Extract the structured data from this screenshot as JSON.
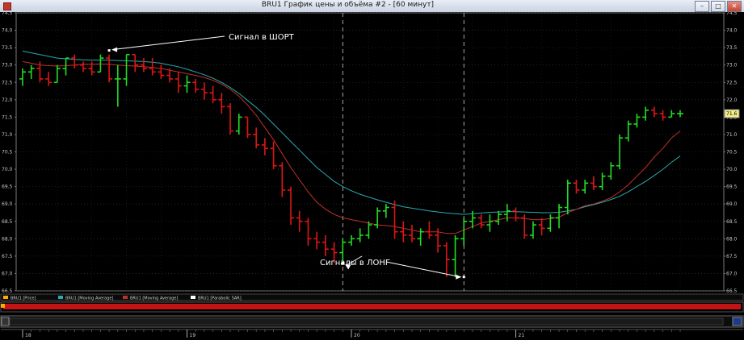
{
  "window": {
    "title": "BRU1 График цены и объёма #2 - [60 минут]",
    "buttons": [
      "–",
      "□",
      "✕"
    ]
  },
  "chart_data": {
    "type": "ohlc",
    "symbol": "BRU1",
    "ylim": [
      66.5,
      74.5
    ],
    "y_ticks": [
      "74.5",
      "74.0",
      "73.5",
      "73.0",
      "72.5",
      "72.0",
      "71.5",
      "71.0",
      "70.5",
      "70.0",
      "69.5",
      "69.0",
      "68.5",
      "68.0",
      "67.5",
      "67.0",
      "66.5"
    ],
    "y_axis_side": "both",
    "last_price_label": "71.6",
    "grid": true,
    "bars": [
      {
        "o": 72.6,
        "h": 72.9,
        "l": 72.4,
        "c": 72.8
      },
      {
        "o": 72.8,
        "h": 73.0,
        "l": 72.6,
        "c": 72.9
      },
      {
        "o": 72.9,
        "h": 73.1,
        "l": 72.5,
        "c": 72.6
      },
      {
        "o": 72.6,
        "h": 72.8,
        "l": 72.4,
        "c": 72.5
      },
      {
        "o": 72.5,
        "h": 73.0,
        "l": 72.5,
        "c": 72.9
      },
      {
        "o": 72.9,
        "h": 73.2,
        "l": 72.7,
        "c": 73.2
      },
      {
        "o": 73.2,
        "h": 73.3,
        "l": 72.9,
        "c": 73.0
      },
      {
        "o": 73.0,
        "h": 73.1,
        "l": 72.8,
        "c": 72.9
      },
      {
        "o": 72.9,
        "h": 73.1,
        "l": 72.7,
        "c": 72.8
      },
      {
        "o": 72.8,
        "h": 73.3,
        "l": 72.8,
        "c": 73.2
      },
      {
        "o": 73.2,
        "h": 73.3,
        "l": 72.5,
        "c": 72.6
      },
      {
        "o": 72.6,
        "h": 73.0,
        "l": 71.8,
        "c": 72.6
      },
      {
        "o": 72.6,
        "h": 73.3,
        "l": 72.4,
        "c": 73.3
      },
      {
        "o": 73.3,
        "h": 73.3,
        "l": 72.8,
        "c": 73.0
      },
      {
        "o": 73.0,
        "h": 73.2,
        "l": 72.8,
        "c": 72.9
      },
      {
        "o": 72.9,
        "h": 73.2,
        "l": 72.7,
        "c": 72.8
      },
      {
        "o": 72.8,
        "h": 73.0,
        "l": 72.6,
        "c": 72.7
      },
      {
        "o": 72.7,
        "h": 72.9,
        "l": 72.5,
        "c": 72.6
      },
      {
        "o": 72.6,
        "h": 72.8,
        "l": 72.2,
        "c": 72.4
      },
      {
        "o": 72.4,
        "h": 72.7,
        "l": 72.2,
        "c": 72.5
      },
      {
        "o": 72.5,
        "h": 72.6,
        "l": 72.2,
        "c": 72.3
      },
      {
        "o": 72.3,
        "h": 72.5,
        "l": 72.0,
        "c": 72.2
      },
      {
        "o": 72.2,
        "h": 72.4,
        "l": 71.9,
        "c": 72.0
      },
      {
        "o": 72.0,
        "h": 72.2,
        "l": 71.6,
        "c": 71.8
      },
      {
        "o": 71.8,
        "h": 71.9,
        "l": 71.0,
        "c": 71.1
      },
      {
        "o": 71.1,
        "h": 71.6,
        "l": 71.0,
        "c": 71.5
      },
      {
        "o": 71.5,
        "h": 71.5,
        "l": 70.9,
        "c": 71.0
      },
      {
        "o": 71.0,
        "h": 71.2,
        "l": 70.6,
        "c": 70.7
      },
      {
        "o": 70.7,
        "h": 70.9,
        "l": 70.4,
        "c": 70.6
      },
      {
        "o": 70.6,
        "h": 70.8,
        "l": 70.0,
        "c": 70.1
      },
      {
        "o": 70.1,
        "h": 70.2,
        "l": 69.2,
        "c": 69.4
      },
      {
        "o": 69.4,
        "h": 69.5,
        "l": 68.4,
        "c": 68.6
      },
      {
        "o": 68.6,
        "h": 68.8,
        "l": 68.2,
        "c": 68.5
      },
      {
        "o": 68.5,
        "h": 68.6,
        "l": 67.8,
        "c": 68.0
      },
      {
        "o": 68.0,
        "h": 68.2,
        "l": 67.7,
        "c": 67.9
      },
      {
        "o": 67.9,
        "h": 68.1,
        "l": 67.5,
        "c": 67.7
      },
      {
        "o": 67.7,
        "h": 67.9,
        "l": 67.3,
        "c": 67.6
      },
      {
        "o": 67.6,
        "h": 68.0,
        "l": 67.3,
        "c": 67.9
      },
      {
        "o": 67.9,
        "h": 68.1,
        "l": 67.8,
        "c": 68.0
      },
      {
        "o": 68.0,
        "h": 68.3,
        "l": 67.9,
        "c": 68.1
      },
      {
        "o": 68.1,
        "h": 68.5,
        "l": 68.0,
        "c": 68.4
      },
      {
        "o": 68.4,
        "h": 68.9,
        "l": 68.3,
        "c": 68.8
      },
      {
        "o": 68.8,
        "h": 69.0,
        "l": 68.6,
        "c": 68.9
      },
      {
        "o": 68.9,
        "h": 69.1,
        "l": 68.0,
        "c": 68.2
      },
      {
        "o": 68.2,
        "h": 68.5,
        "l": 67.9,
        "c": 68.1
      },
      {
        "o": 68.1,
        "h": 68.4,
        "l": 67.9,
        "c": 68.0
      },
      {
        "o": 68.0,
        "h": 68.3,
        "l": 67.8,
        "c": 68.2
      },
      {
        "o": 68.2,
        "h": 68.5,
        "l": 68.0,
        "c": 68.1
      },
      {
        "o": 68.1,
        "h": 68.3,
        "l": 67.6,
        "c": 67.8
      },
      {
        "o": 67.8,
        "h": 67.9,
        "l": 66.9,
        "c": 67.4
      },
      {
        "o": 67.4,
        "h": 68.1,
        "l": 66.9,
        "c": 68.0
      },
      {
        "o": 68.0,
        "h": 68.6,
        "l": 67.8,
        "c": 68.5
      },
      {
        "o": 68.5,
        "h": 68.8,
        "l": 68.3,
        "c": 68.6
      },
      {
        "o": 68.6,
        "h": 68.7,
        "l": 68.3,
        "c": 68.4
      },
      {
        "o": 68.4,
        "h": 68.7,
        "l": 68.2,
        "c": 68.5
      },
      {
        "o": 68.5,
        "h": 68.8,
        "l": 68.4,
        "c": 68.7
      },
      {
        "o": 68.7,
        "h": 69.0,
        "l": 68.5,
        "c": 68.8
      },
      {
        "o": 68.8,
        "h": 68.9,
        "l": 68.5,
        "c": 68.6
      },
      {
        "o": 68.6,
        "h": 68.7,
        "l": 68.0,
        "c": 68.1
      },
      {
        "o": 68.1,
        "h": 68.5,
        "l": 68.0,
        "c": 68.4
      },
      {
        "o": 68.4,
        "h": 68.6,
        "l": 68.1,
        "c": 68.3
      },
      {
        "o": 68.3,
        "h": 68.7,
        "l": 68.2,
        "c": 68.6
      },
      {
        "o": 68.6,
        "h": 69.0,
        "l": 68.3,
        "c": 68.9
      },
      {
        "o": 68.9,
        "h": 69.7,
        "l": 68.7,
        "c": 69.6
      },
      {
        "o": 69.6,
        "h": 69.7,
        "l": 69.3,
        "c": 69.4
      },
      {
        "o": 69.4,
        "h": 69.7,
        "l": 69.3,
        "c": 69.6
      },
      {
        "o": 69.6,
        "h": 69.8,
        "l": 69.4,
        "c": 69.5
      },
      {
        "o": 69.5,
        "h": 69.9,
        "l": 69.4,
        "c": 69.8
      },
      {
        "o": 69.8,
        "h": 70.2,
        "l": 69.7,
        "c": 70.1
      },
      {
        "o": 70.1,
        "h": 71.0,
        "l": 70.0,
        "c": 70.9
      },
      {
        "o": 70.9,
        "h": 71.4,
        "l": 70.8,
        "c": 71.3
      },
      {
        "o": 71.3,
        "h": 71.6,
        "l": 71.2,
        "c": 71.5
      },
      {
        "o": 71.5,
        "h": 71.8,
        "l": 71.4,
        "c": 71.7
      },
      {
        "o": 71.7,
        "h": 71.8,
        "l": 71.5,
        "c": 71.6
      },
      {
        "o": 71.6,
        "h": 71.7,
        "l": 71.4,
        "c": 71.5
      },
      {
        "o": 71.5,
        "h": 71.7,
        "l": 71.5,
        "c": 71.6
      },
      {
        "o": 71.6,
        "h": 71.7,
        "l": 71.5,
        "c": 71.6
      }
    ],
    "ma_fast": [
      73.1,
      73.05,
      73.0,
      72.98,
      72.97,
      72.98,
      73.0,
      73.02,
      73.02,
      73.03,
      73.02,
      73.0,
      72.98,
      72.97,
      72.95,
      72.93,
      72.9,
      72.85,
      72.8,
      72.75,
      72.7,
      72.64,
      72.56,
      72.45,
      72.3,
      72.1,
      71.85,
      71.55,
      71.2,
      70.85,
      70.45,
      70.05,
      69.7,
      69.35,
      69.05,
      68.85,
      68.7,
      68.6,
      68.55,
      68.5,
      68.45,
      68.4,
      68.38,
      68.35,
      68.3,
      68.25,
      68.2,
      68.2,
      68.2,
      68.15,
      68.15,
      68.25,
      68.35,
      68.45,
      68.5,
      68.55,
      68.6,
      68.6,
      68.58,
      68.55,
      68.55,
      68.58,
      68.62,
      68.75,
      68.85,
      68.95,
      69.0,
      69.08,
      69.18,
      69.35,
      69.55,
      69.8,
      70.05,
      70.35,
      70.6,
      70.9,
      71.1
    ],
    "ma_slow": [
      73.4,
      73.35,
      73.3,
      73.25,
      73.2,
      73.18,
      73.16,
      73.15,
      73.14,
      73.14,
      73.14,
      73.13,
      73.12,
      73.11,
      73.1,
      73.08,
      73.05,
      73.0,
      72.95,
      72.88,
      72.8,
      72.72,
      72.62,
      72.5,
      72.35,
      72.18,
      71.98,
      71.78,
      71.55,
      71.3,
      71.05,
      70.8,
      70.55,
      70.3,
      70.05,
      69.85,
      69.65,
      69.5,
      69.38,
      69.28,
      69.2,
      69.12,
      69.05,
      68.98,
      68.92,
      68.88,
      68.84,
      68.8,
      68.77,
      68.74,
      68.72,
      68.7,
      68.72,
      68.74,
      68.76,
      68.77,
      68.78,
      68.78,
      68.77,
      68.76,
      68.75,
      68.75,
      68.76,
      68.8,
      68.85,
      68.92,
      68.98,
      69.05,
      69.13,
      69.22,
      69.35,
      69.5,
      69.65,
      69.82,
      70.0,
      70.2,
      70.38
    ],
    "ma_fast_color": "#c0302a",
    "ma_slow_color": "#2aa9b0",
    "up_color": "#22dd22",
    "down_color": "#e01515",
    "sar_points": [
      {
        "bar": 10,
        "price": 73.42
      },
      {
        "bar": 37,
        "price": 67.3
      },
      {
        "bar": 51,
        "price": 66.9
      }
    ],
    "signal_lines_at_bars": [
      37,
      51
    ],
    "annotations": [
      {
        "text": "Сигнал    в ШОРТ",
        "target_bar": 10,
        "target_price": 73.42
      },
      {
        "text": "Сигналы в ЛОНГ",
        "target_bars": [
          37,
          51
        ]
      }
    ],
    "x_labels": [
      {
        "bar": 0,
        "text": "18"
      },
      {
        "bar": 19,
        "text": "19"
      },
      {
        "bar": 38,
        "text": "20"
      },
      {
        "bar": 57,
        "text": "21"
      }
    ],
    "legend": [
      {
        "label": "BRU1 [Price]",
        "color": "#ffaa00"
      },
      {
        "label": "BRU1 [Moving Average]",
        "color": "#2aa9b0"
      },
      {
        "label": "BRU1 [Moving Average]",
        "color": "#c0302a"
      },
      {
        "label": "BRU1 [Parabolic SAR]",
        "color": "#ffffff"
      }
    ]
  }
}
